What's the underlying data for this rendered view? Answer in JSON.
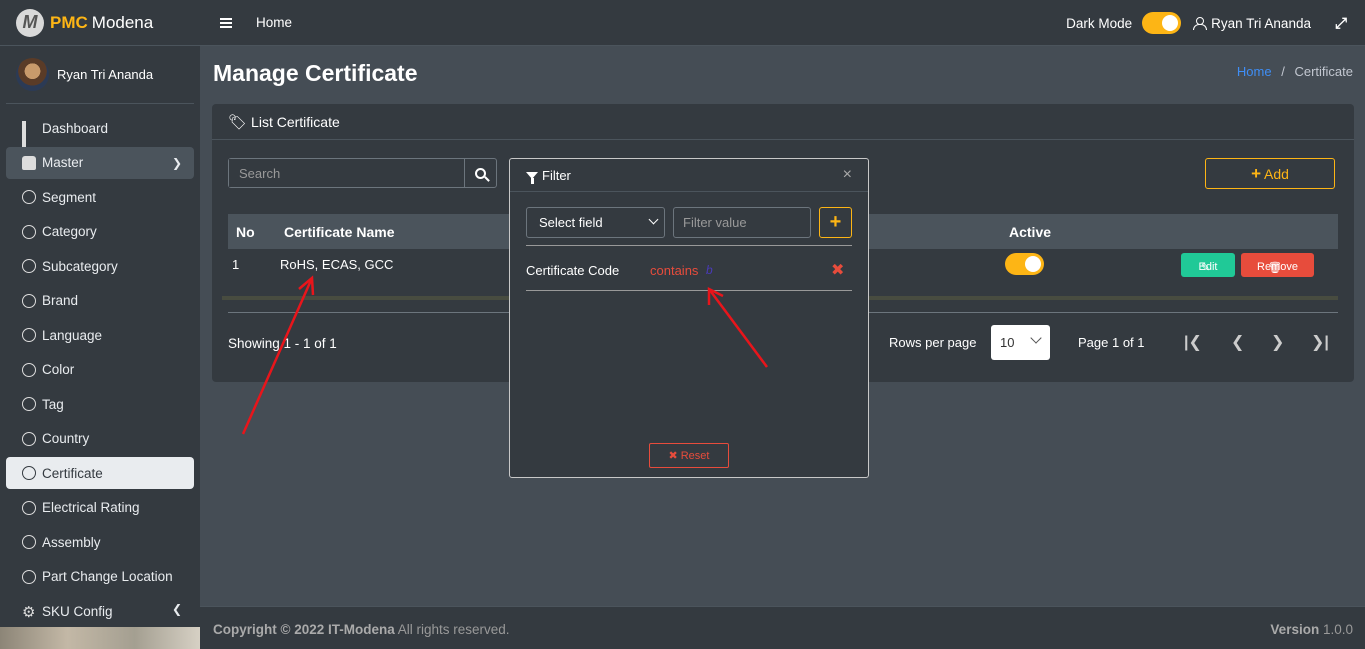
{
  "brand": {
    "bold": "PMC",
    "name": "Modena",
    "logo": "M"
  },
  "user": {
    "name": "Ryan Tri Ananda"
  },
  "sidebar": {
    "items": [
      {
        "label": "Dashboard"
      },
      {
        "label": "Master"
      },
      {
        "label": "Segment"
      },
      {
        "label": "Category"
      },
      {
        "label": "Subcategory"
      },
      {
        "label": "Brand"
      },
      {
        "label": "Language"
      },
      {
        "label": "Color"
      },
      {
        "label": "Tag"
      },
      {
        "label": "Country"
      },
      {
        "label": "Certificate"
      },
      {
        "label": "Electrical Rating"
      },
      {
        "label": "Assembly"
      },
      {
        "label": "Part Change Location"
      },
      {
        "label": "SKU Config"
      }
    ]
  },
  "topbar": {
    "home": "Home",
    "dark_mode": "Dark Mode",
    "user": "Ryan Tri Ananda"
  },
  "page": {
    "title": "Manage Certificate",
    "breadcrumb_home": "Home",
    "breadcrumb_sep": "/",
    "breadcrumb_current": "Certificate"
  },
  "card": {
    "title": "List Certificate",
    "search_placeholder": "Search",
    "add_label": "Add"
  },
  "table": {
    "headers": {
      "no": "No",
      "name": "Certificate Name",
      "active": "Active"
    },
    "rows": [
      {
        "no": "1",
        "name": "RoHS, ECAS, GCC",
        "edit": "Edit",
        "remove": "Remove"
      }
    ]
  },
  "pagination": {
    "showing": "Showing 1 - 1 of 1",
    "rows_per_page": "Rows per page",
    "rows_value": "10",
    "page": "Page 1 of 1"
  },
  "filter": {
    "title": "Filter",
    "select_placeholder": "Select field",
    "value_placeholder": "Filter value",
    "rule": {
      "field": "Certificate Code",
      "operator": "contains",
      "value": "b"
    },
    "reset": "Reset"
  },
  "footer": {
    "copyright": "Copyright © 2022",
    "company": "IT-Modena",
    "rights": "All rights reserved.",
    "version_label": "Version",
    "version": "1.0.0"
  },
  "colors": {
    "accent": "#fdb515",
    "danger": "#e74c3c",
    "success": "#20c997",
    "link": "#3f8ef5"
  }
}
